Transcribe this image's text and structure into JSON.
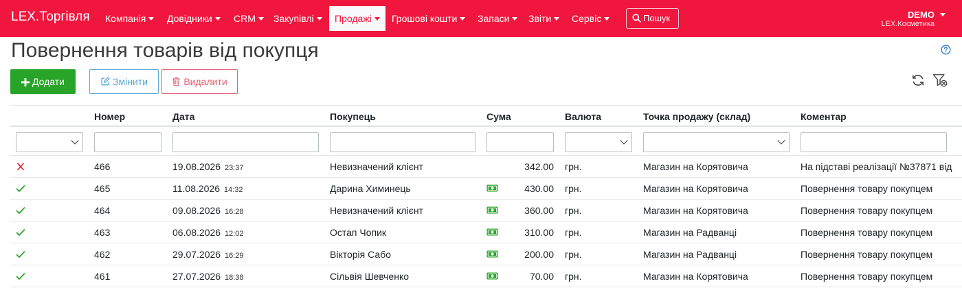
{
  "nav": {
    "brand": "LEX.Торгівля",
    "items": [
      {
        "label": "Компанія"
      },
      {
        "label": "Довідники"
      },
      {
        "label": "CRM"
      },
      {
        "label": "Закупівлі"
      },
      {
        "label": "Продажі",
        "active": true
      },
      {
        "label": "Грошові кошти"
      },
      {
        "label": "Запаси"
      },
      {
        "label": "Звіти"
      },
      {
        "label": "Сервіс"
      }
    ],
    "search_label": "Пошук",
    "user": "DEMO",
    "company": "LEX.Косметика"
  },
  "page": {
    "title": "Повернення товарів від покупця"
  },
  "toolbar": {
    "add_label": "Додати",
    "edit_label": "Змінити",
    "delete_label": "Видалити",
    "refresh_icon": "refresh-icon",
    "clear_filter_icon": "clear-filter-icon"
  },
  "table": {
    "columns": [
      "Номер",
      "Дата",
      "Покупець",
      "Сума",
      "Валюта",
      "Точка продажу (склад)",
      "Коментар"
    ],
    "rows": [
      {
        "status": "cancelled",
        "number": "466",
        "date": "19.08.2026",
        "time": "23:37",
        "customer": "Невизначений клієнт",
        "paid": false,
        "amount": "342.00",
        "currency": "грн.",
        "point": "Магазин на Корятовича",
        "comment": "На підставі реалізації №37871 від"
      },
      {
        "status": "done",
        "number": "465",
        "date": "11.08.2026",
        "time": "14:32",
        "customer": "Дарина Химинець",
        "paid": true,
        "amount": "430.00",
        "currency": "грн.",
        "point": "Магазин на Корятовича",
        "comment": "Повернення товару покупцем"
      },
      {
        "status": "done",
        "number": "464",
        "date": "09.08.2026",
        "time": "16:28",
        "customer": "Невизначений клієнт",
        "paid": true,
        "amount": "360.00",
        "currency": "грн.",
        "point": "Магазин на Корятовича",
        "comment": "Повернення товару покупцем"
      },
      {
        "status": "done",
        "number": "463",
        "date": "06.08.2026",
        "time": "12:02",
        "customer": "Остап Чопик",
        "paid": true,
        "amount": "310.00",
        "currency": "грн.",
        "point": "Магазин на Радванці",
        "comment": "Повернення товару покупцем"
      },
      {
        "status": "done",
        "number": "462",
        "date": "29.07.2026",
        "time": "16:29",
        "customer": "Вікторія Сабо",
        "paid": true,
        "amount": "200.00",
        "currency": "грн.",
        "point": "Магазин на Радванці",
        "comment": "Повернення товару покупцем"
      },
      {
        "status": "done",
        "number": "461",
        "date": "27.07.2026",
        "time": "18:38",
        "customer": "Сільвія Шевченко",
        "paid": true,
        "amount": "70.00",
        "currency": "грн.",
        "point": "Магазин на Корятовича",
        "comment": "Повернення товару покупцем"
      }
    ]
  },
  "colors": {
    "brand": "#f0163d",
    "add": "#28a428",
    "edit": "#5aa7d6",
    "delete": "#e06070",
    "ok": "#28a428",
    "cancel": "#e0202f"
  }
}
